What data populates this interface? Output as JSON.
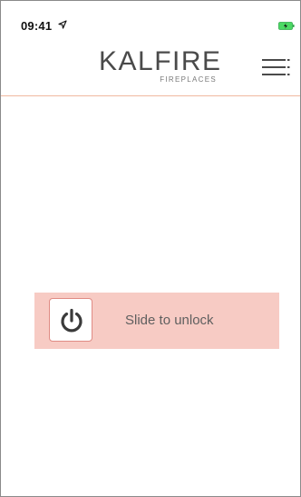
{
  "status_bar": {
    "time": "09:41",
    "location_icon": "location-arrow-icon",
    "battery_icon": "battery-charging-icon",
    "battery_color": "#4cd964"
  },
  "header": {
    "logo_main": "KALFIRE",
    "logo_sub": "FIREPLACES",
    "menu_icon": "hamburger-menu-icon",
    "divider_color": "#f0b8a0"
  },
  "slider": {
    "label": "Slide to unlock",
    "handle_icon": "power-icon",
    "track_color": "#f7cbc4",
    "handle_border_color": "#e08b84"
  }
}
